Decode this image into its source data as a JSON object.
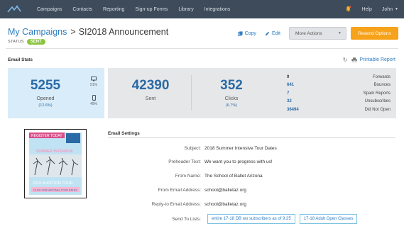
{
  "nav": {
    "items": [
      "Campaigns",
      "Contacts",
      "Reporting",
      "Sign-up Forms",
      "Library",
      "Integrations"
    ],
    "help": "Help",
    "user": "John"
  },
  "header": {
    "breadcrumb_link": "My Campaigns",
    "separator": ">",
    "title": "SI2018 Announcement",
    "status_label": "STATUS",
    "status_value": "SENT",
    "copy_label": "Copy",
    "edit_label": "Edit",
    "more_actions_label": "More Actions",
    "resend_label": "Resend Options"
  },
  "stats": {
    "section_title": "Email Stats",
    "print_label": "Printable Report",
    "opened": {
      "value": "5255",
      "label": "Opened",
      "pct": "(12.6%)"
    },
    "devices": {
      "desktop_pct": "51%",
      "mobile_pct": "49%"
    },
    "sent": {
      "value": "42390",
      "label": "Sent"
    },
    "clicks": {
      "value": "352",
      "label": "Clicks",
      "pct": "(6.7%)"
    },
    "side": [
      {
        "value": "0",
        "label": "Forwards"
      },
      {
        "value": "641",
        "label": "Bounces"
      },
      {
        "value": "7",
        "label": "Spam Reports"
      },
      {
        "value": "32",
        "label": "Unsubscribes"
      },
      {
        "value": "36494",
        "label": "Did Not Open"
      }
    ]
  },
  "preview": {
    "line1": "REGISTER TODAY",
    "line2": "SUMMER INTENSIVE",
    "line3": "2018 AUDITION TOUR",
    "line4": "CLICK FOR NATIONAL TOUR DATES"
  },
  "settings": {
    "section_title": "Email Settings",
    "subject_label": "Subject:",
    "subject": "2018 Summer Intensive Tour Dates",
    "preheader_label": "Preheader Text:",
    "preheader": "We want you to progress with us!",
    "from_name_label": "From Name:",
    "from_name": "The School of Ballet Arizona",
    "from_email_label": "From Email Address:",
    "from_email": "school@balletaz.org",
    "reply_to_label": "Reply-to Email Address:",
    "reply_to": "school@balletaz.org",
    "send_to_label": "Send To Lists:",
    "lists": [
      "entire 17-18 DB wo subscribers as of 9:25",
      "17-18 Adult Open Classes"
    ]
  },
  "colors": {
    "nav": "#3d4b5a",
    "accent": "#2b7dc1",
    "resend": "#f7a21b",
    "status": "#8cc63f",
    "opened_bg": "#d9ecf9"
  }
}
